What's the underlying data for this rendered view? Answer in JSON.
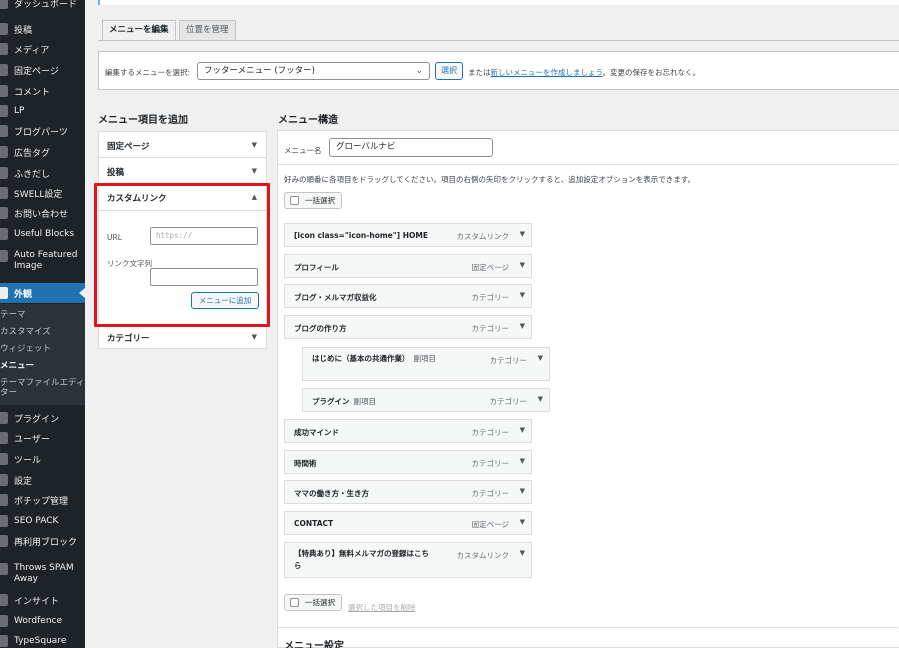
{
  "sidebar": {
    "items": [
      {
        "label": "ダッシュボード"
      },
      {
        "label": "投稿"
      },
      {
        "label": "メディア"
      },
      {
        "label": "固定ページ"
      },
      {
        "label": "コメント"
      },
      {
        "label": "LP"
      },
      {
        "label": "ブログパーツ"
      },
      {
        "label": "広告タグ"
      },
      {
        "label": "ふきだし"
      },
      {
        "label": "SWELL設定"
      },
      {
        "label": "お問い合わせ"
      },
      {
        "label": "Useful Blocks"
      },
      {
        "label": "Auto Featured Image"
      },
      {
        "label": "外観"
      },
      {
        "label": "プラグイン"
      },
      {
        "label": "ユーザー"
      },
      {
        "label": "ツール"
      },
      {
        "label": "設定"
      },
      {
        "label": "ポチップ管理"
      },
      {
        "label": "SEO PACK"
      },
      {
        "label": "再利用ブロック"
      },
      {
        "label": "Throws SPAM Away"
      },
      {
        "label": "インサイト"
      },
      {
        "label": "Wordfence"
      },
      {
        "label": "TypeSquare"
      }
    ],
    "submenu": [
      {
        "label": "テーマ"
      },
      {
        "label": "カスタマイズ"
      },
      {
        "label": "ウィジェット"
      },
      {
        "label": "メニュー"
      },
      {
        "label": "テーマファイルエディター"
      }
    ]
  },
  "tabs": {
    "edit": "メニューを編集",
    "manage": "位置を管理"
  },
  "select_bar": {
    "label": "編集するメニューを選択:",
    "selected": "フッターメニュー (フッター)",
    "button": "選択",
    "note_prefix": "または",
    "note_link": "新しいメニューを作成しましょう",
    "note_suffix": "。変更の保存をお忘れなく。"
  },
  "add_items": {
    "title": "メニュー項目を追加",
    "panels": {
      "pages": "固定ページ",
      "posts": "投稿",
      "custom": "カスタムリンク",
      "categories": "カテゴリー"
    },
    "custom_link": {
      "url_label": "URL",
      "url_placeholder": "https://",
      "text_label": "リンク文字列",
      "text_value": "",
      "add_button": "メニューに追加"
    },
    "arrows": {
      "collapsed": "▼",
      "expanded": "▲"
    }
  },
  "structure": {
    "title": "メニュー構造",
    "menu_name_label": "メニュー名",
    "menu_name": "グローバルナビ",
    "instruction": "好みの順番に各項目をドラッグしてください。項目の右側の矢印をクリックすると、追加設定オプションを表示できます。",
    "bulk_select": "一括選択",
    "remove_selected": "選択した項目を削除",
    "items": [
      {
        "title": "[icon class=\"icon-home\"] HOME",
        "type": "カスタムリンク",
        "sub": ""
      },
      {
        "title": "プロフィール",
        "type": "固定ページ",
        "sub": ""
      },
      {
        "title": "ブログ・メルマガ収益化",
        "type": "カテゴリー",
        "sub": ""
      },
      {
        "title": "ブログの作り方",
        "type": "カテゴリー",
        "sub": ""
      },
      {
        "title": "はじめに（基本の共通作業）",
        "type": "カテゴリー",
        "sub": "副項目"
      },
      {
        "title": "プラグイン",
        "type": "カテゴリー",
        "sub": "副項目"
      },
      {
        "title": "成功マインド",
        "type": "カテゴリー",
        "sub": ""
      },
      {
        "title": "時間術",
        "type": "カテゴリー",
        "sub": ""
      },
      {
        "title": "ママの働き方・生き方",
        "type": "カテゴリー",
        "sub": ""
      },
      {
        "title": "CONTACT",
        "type": "固定ページ",
        "sub": ""
      },
      {
        "title": "【特典あり】無料メルマガの登録はこちら",
        "type": "カスタムリンク",
        "sub": ""
      }
    ],
    "item_arrow": "▼",
    "settings_title": "メニュー設定"
  },
  "colors": {
    "sidebar_bg": "#1d2327",
    "accent": "#2271b1",
    "highlight_box": "#e0141e"
  }
}
